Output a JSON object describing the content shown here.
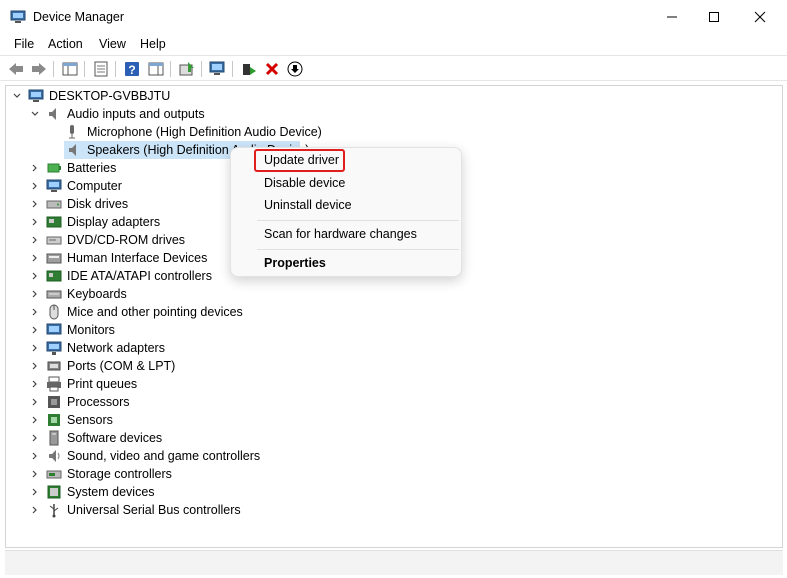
{
  "window": {
    "title": "Device Manager"
  },
  "menu": [
    "File",
    "Action",
    "View",
    "Help"
  ],
  "colors": {
    "accent": "#0067c0",
    "selection": "#cce4f7",
    "highlight_border": "#e01e1e",
    "delete_red": "#d40000"
  },
  "toolbar": {
    "icons": [
      "back-arrow-icon",
      "forward-arrow-icon",
      "show-hide-console-tree-icon",
      "properties-icon",
      "help-icon",
      "action-pane-icon",
      "update-driver-icon",
      "scan-hardware-icon",
      "enable-device-icon",
      "uninstall-device-icon",
      "disable-device-icon"
    ]
  },
  "tree": {
    "root": "DESKTOP-GVBBJTU",
    "audio": {
      "label": "Audio inputs and outputs",
      "children": [
        "Microphone (High Definition Audio Device)",
        "Speakers (High Definition Audio Device)"
      ]
    },
    "categories": [
      "Batteries",
      "Computer",
      "Disk drives",
      "Display adapters",
      "DVD/CD-ROM drives",
      "Human Interface Devices",
      "IDE ATA/ATAPI controllers",
      "Keyboards",
      "Mice and other pointing devices",
      "Monitors",
      "Network adapters",
      "Ports (COM & LPT)",
      "Print queues",
      "Processors",
      "Sensors",
      "Software devices",
      "Sound, video and game controllers",
      "Storage controllers",
      "System devices",
      "Universal Serial Bus controllers"
    ]
  },
  "context_menu": {
    "update_driver": "Update driver",
    "disable_device": "Disable device",
    "uninstall_device": "Uninstall device",
    "scan_hardware": "Scan for hardware changes",
    "properties": "Properties"
  }
}
